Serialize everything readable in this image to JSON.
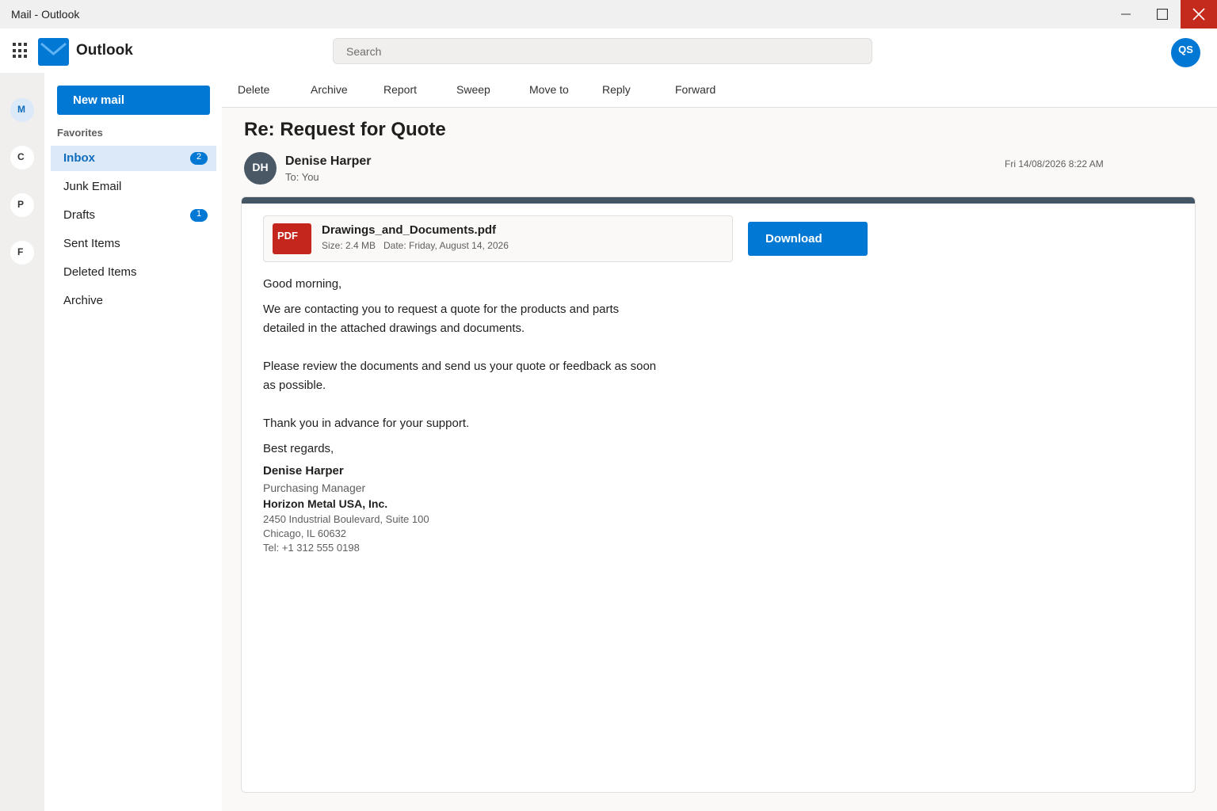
{
  "window": {
    "title": "Mail - Outlook",
    "controls": [
      "minimize-icon",
      "maximize-icon",
      "close-icon"
    ],
    "close_color": "#c42b1c"
  },
  "header": {
    "app_name": "Outlook",
    "search_placeholder": "Search",
    "account_initials": "QS",
    "brand_color": "#0078d4"
  },
  "rail": {
    "items": [
      {
        "label": "M",
        "active": true
      },
      {
        "label": "C",
        "active": false
      },
      {
        "label": "P",
        "active": false
      },
      {
        "label": "F",
        "active": false
      }
    ]
  },
  "folders": {
    "new_mail_label": "New mail",
    "favorites_label": "Favorites",
    "items": [
      {
        "label": "Inbox",
        "count": "2",
        "active": true
      },
      {
        "label": "Junk Email",
        "count": "",
        "active": false
      },
      {
        "label": "Drafts",
        "count": "1",
        "active": false
      },
      {
        "label": "Sent Items",
        "count": "",
        "active": false
      },
      {
        "label": "Deleted Items",
        "count": "",
        "active": false
      },
      {
        "label": "Archive",
        "count": "",
        "active": false
      }
    ]
  },
  "toolbar": {
    "actions": [
      "Delete",
      "Archive",
      "Report",
      "Sweep",
      "Move to",
      "Reply",
      "Forward"
    ]
  },
  "message": {
    "subject": "Re: Request for Quote",
    "sender_initials": "DH",
    "sender_name": "Denise Harper",
    "recipient": "To: You",
    "datetime": "Fri 14/08/2026 8:22 AM",
    "attachment": {
      "type_label": "PDF",
      "name": "Drawings_and_Documents.pdf",
      "size": "Size: 2.4 MB",
      "date": "Date: Friday, August 14, 2026",
      "download_label": "Download"
    },
    "greeting": "Good morning,",
    "paragraph1_line1": "We are contacting you to request a quote for the products and parts",
    "paragraph1_line2": "detailed in the attached drawings and documents.",
    "paragraph2_line1": "Please review the documents and send us your quote or feedback as soon",
    "paragraph2_line2": "as possible.",
    "thanks": "Thank you in advance for your support.",
    "closing": "Best regards,",
    "signature": {
      "name": "Denise Harper",
      "title": "Purchasing Manager",
      "company": "Horizon Metal USA, Inc.",
      "address1": "2450 Industrial Boulevard, Suite 100",
      "address2": "Chicago, IL 60632",
      "phone": "Tel: +1 312 555 0198"
    }
  }
}
